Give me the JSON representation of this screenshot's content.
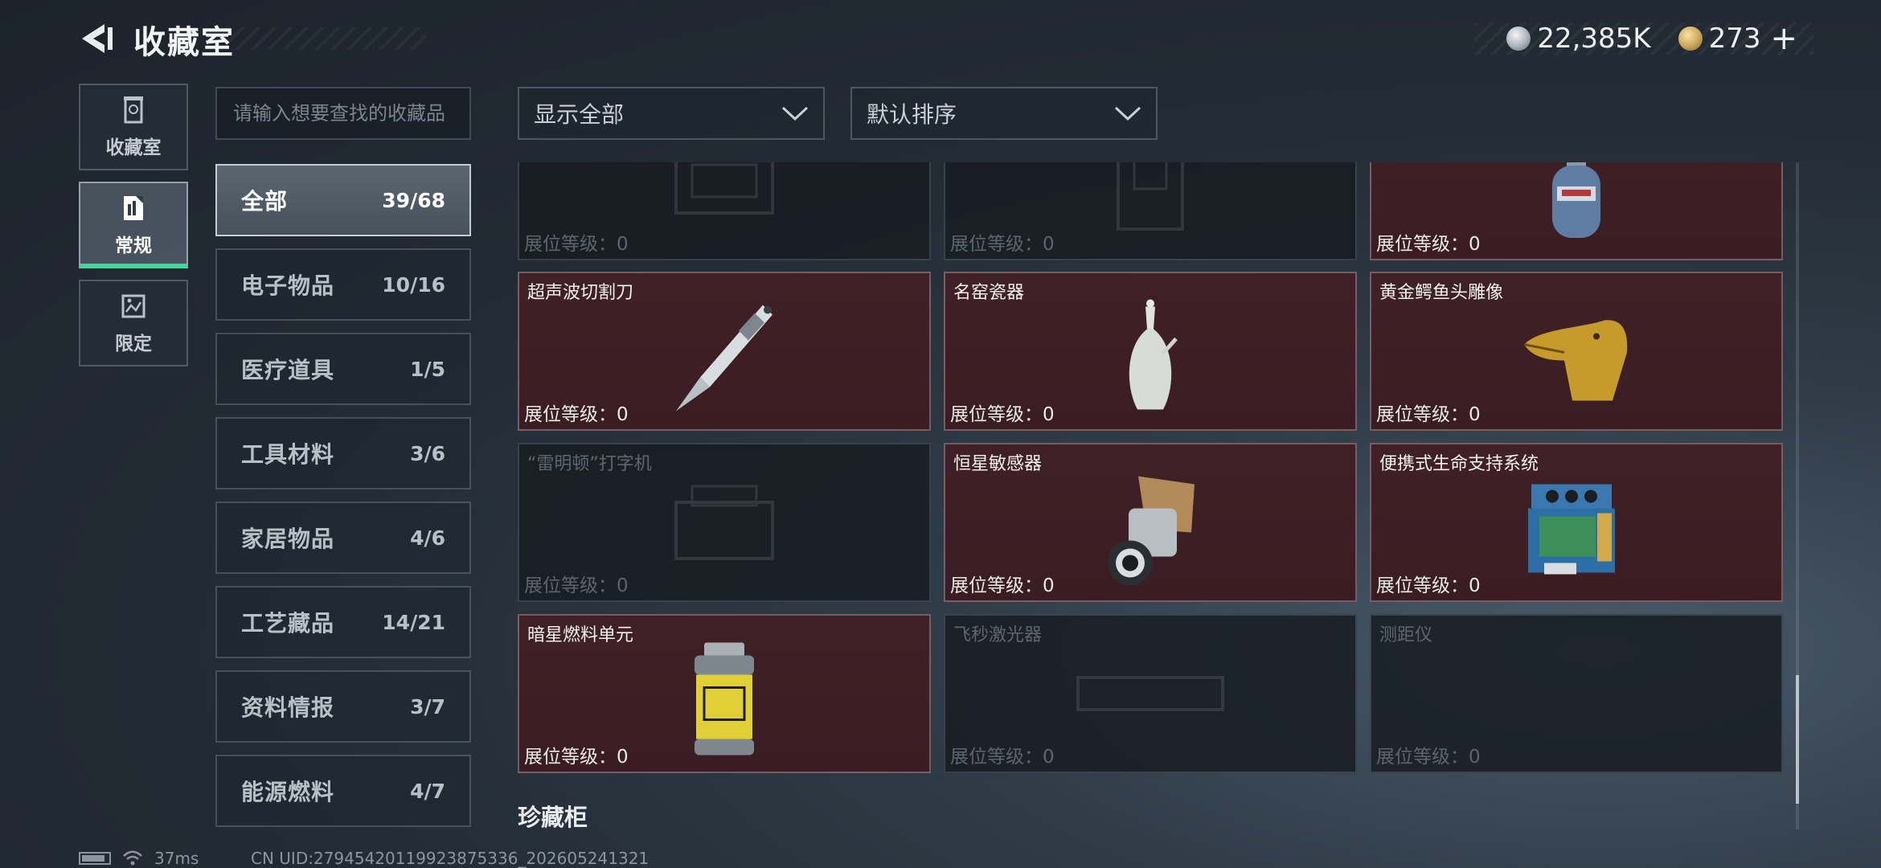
{
  "header": {
    "title": "收藏室",
    "currency_silver": "22,385K",
    "currency_gold": "273",
    "plus_label": "+"
  },
  "side_tabs": [
    {
      "label": "收藏室",
      "icon": "trophy-room-icon",
      "active": false
    },
    {
      "label": "常规",
      "icon": "regular-collection-icon",
      "active": true
    },
    {
      "label": "限定",
      "icon": "limited-collection-icon",
      "active": false
    }
  ],
  "search": {
    "placeholder": "请输入想要查找的收藏品"
  },
  "categories": [
    {
      "name": "全部",
      "count": "39/68",
      "active": true
    },
    {
      "name": "电子物品",
      "count": "10/16"
    },
    {
      "name": "医疗道具",
      "count": "1/5"
    },
    {
      "name": "工具材料",
      "count": "3/6"
    },
    {
      "name": "家居物品",
      "count": "4/6"
    },
    {
      "name": "工艺藏品",
      "count": "14/21"
    },
    {
      "name": "资料情报",
      "count": "3/7"
    },
    {
      "name": "能源燃料",
      "count": "4/7"
    }
  ],
  "filters": {
    "filter_label": "显示全部",
    "sort_label": "默认排序"
  },
  "grid": {
    "level_label": "展位等级：",
    "items": [
      {
        "name": "",
        "level": "0",
        "owned": false,
        "icon": "locked-device-icon"
      },
      {
        "name": "",
        "level": "0",
        "owned": false,
        "icon": "locked-cabinet-icon"
      },
      {
        "name": "",
        "level": "0",
        "owned": true,
        "icon": "gas-tank-icon"
      },
      {
        "name": "超声波切割刀",
        "level": "0",
        "owned": true,
        "icon": "ultrasonic-knife-icon"
      },
      {
        "name": "名窑瓷器",
        "level": "0",
        "owned": true,
        "icon": "porcelain-vase-icon"
      },
      {
        "name": "黄金鳄鱼头雕像",
        "level": "0",
        "owned": true,
        "icon": "golden-crocodile-icon"
      },
      {
        "name": "“雷明顿”打字机",
        "level": "0",
        "owned": false,
        "icon": "typewriter-icon"
      },
      {
        "name": "恒星敏感器",
        "level": "0",
        "owned": true,
        "icon": "star-sensor-icon"
      },
      {
        "name": "便携式生命支持系统",
        "level": "0",
        "owned": true,
        "icon": "life-support-icon"
      },
      {
        "name": "暗星燃料单元",
        "level": "0",
        "owned": true,
        "icon": "fuel-cell-icon"
      },
      {
        "name": "飞秒激光器",
        "level": "0",
        "owned": false,
        "icon": "laser-icon"
      },
      {
        "name": "测距仪",
        "level": "0",
        "owned": false,
        "icon": "rangefinder-icon"
      }
    ]
  },
  "section_title": "珍藏柜",
  "status": {
    "ping": "37ms",
    "uid": "CN UID:27945420119923875336_202605241321"
  },
  "colors": {
    "owned_bg": "#3f2026",
    "accent": "#49d29a"
  }
}
